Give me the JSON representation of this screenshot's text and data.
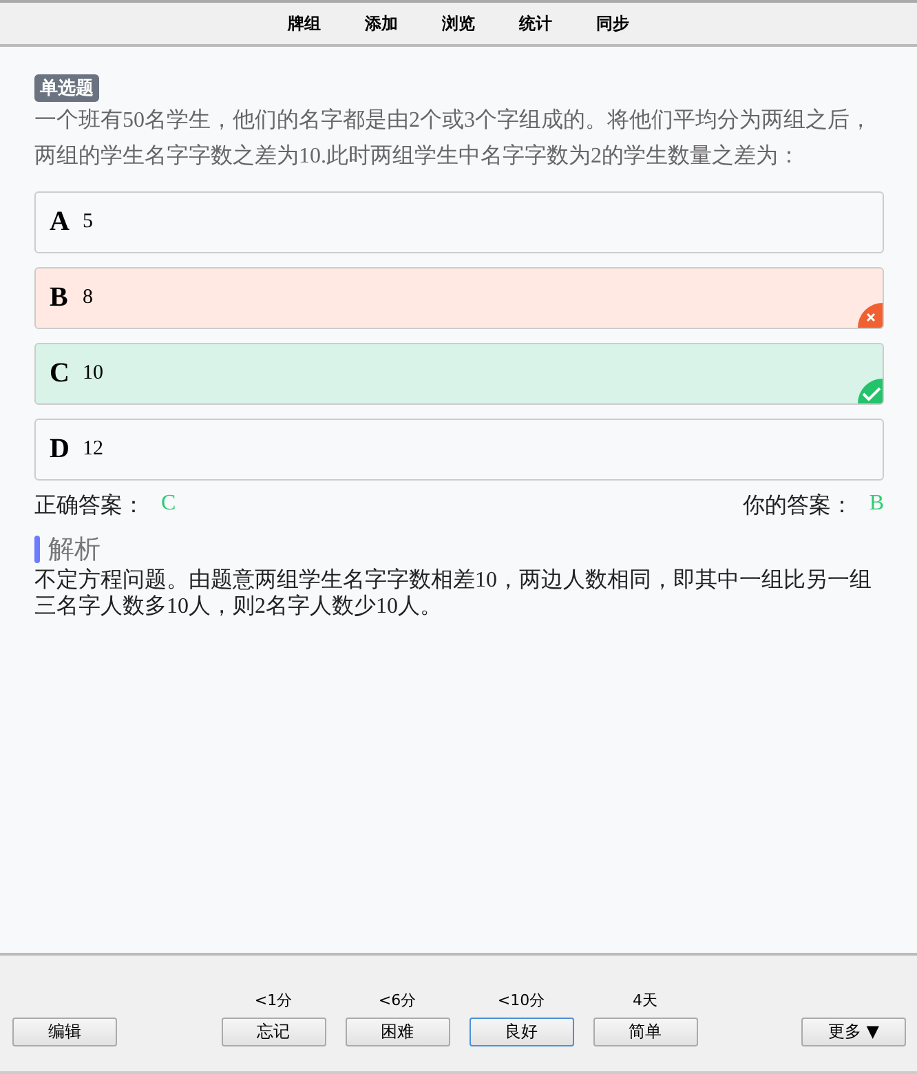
{
  "nav": [
    {
      "label": "牌组"
    },
    {
      "label": "添加"
    },
    {
      "label": "浏览"
    },
    {
      "label": "统计"
    },
    {
      "label": "同步"
    }
  ],
  "question": {
    "tag": "单选题",
    "text": "一个班有50名学生，他们的名字都是由2个或3个字组成的。将他们平均分为两组之后，两组的学生名字字数之差为10.此时两组学生中名字字数为2的学生数量之差为："
  },
  "options": [
    {
      "letter": "A",
      "text": "5",
      "kind": "plain"
    },
    {
      "letter": "B",
      "text": "8",
      "kind": "wrong"
    },
    {
      "letter": "C",
      "text": "10",
      "kind": "correct"
    },
    {
      "letter": "D",
      "text": "12",
      "kind": "plain"
    }
  ],
  "answers": {
    "correct_label": "正确答案：",
    "correct": "C",
    "yours_label": "你的答案：",
    "yours": "B"
  },
  "analysis": {
    "title": "解析",
    "text": "不定方程问题。由题意两组学生名字字数相差10，两边人数相同，即其中一组比另一组三名字人数多10人，则2名字人数少10人。"
  },
  "bottom": {
    "edit": "编辑",
    "ease": [
      {
        "interval": "<1分",
        "label": "忘记",
        "selected": false
      },
      {
        "interval": "<6分",
        "label": "困难",
        "selected": false
      },
      {
        "interval": "<10分",
        "label": "良好",
        "selected": true
      },
      {
        "interval": "4天",
        "label": "简单",
        "selected": false
      }
    ],
    "more": "更多 ▼"
  }
}
